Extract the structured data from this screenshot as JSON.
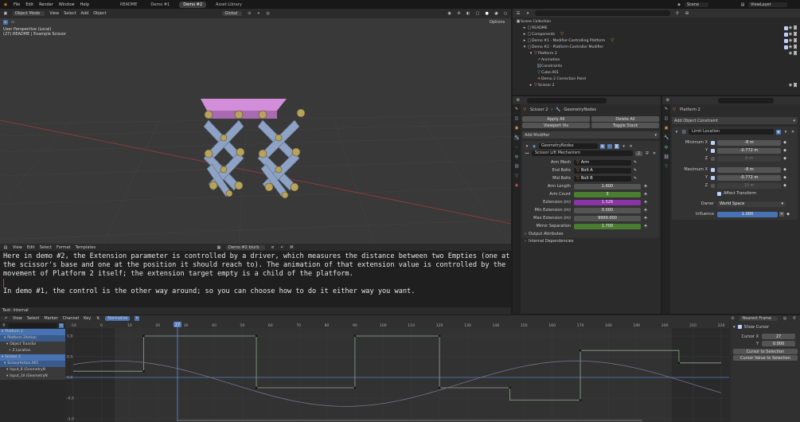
{
  "topbar": {
    "menus": [
      "File",
      "Edit",
      "Render",
      "Window",
      "Help"
    ],
    "tabs": [
      "README",
      "Demo #1",
      "Demo #2",
      "Asset Library"
    ],
    "active_tab": "Demo #2",
    "scene": "Scene",
    "view_layer": "ViewLayer"
  },
  "viewport": {
    "mode": "Object Mode",
    "menus": [
      "View",
      "Select",
      "Add",
      "Object"
    ],
    "transform": "Global",
    "options": "Options",
    "info_line1": "User Perspective (Local)",
    "info_line2": "(27) README | Example Scissor"
  },
  "text_editor": {
    "menus": [
      "View",
      "Edit",
      "Select",
      "Format",
      "Templates"
    ],
    "file_name": "Demo #2 blurb",
    "lines": [
      "Here in demo #2, the Extension parameter is controlled by a driver, which measures the distance between two Empties (one at",
      "the scissor's base and one at the position it should reach to). The animation of that extension value is controlled by the",
      "movement of Platform 2 itself; the extension target empty is a child of the platform.",
      "",
      "In demo #1, the control is the other way around; so you can choose how to do it either way you want."
    ],
    "status": "Text: Internal"
  },
  "outliner": {
    "items": [
      {
        "label": "Scene Collection",
        "depth": 0
      },
      {
        "label": "README",
        "depth": 1
      },
      {
        "label": "Components",
        "depth": 1
      },
      {
        "label": "Demo #1 - Modifier-Controlling Platform",
        "depth": 1
      },
      {
        "label": "Demo #2 - Platform-Controller Modifier",
        "depth": 1
      },
      {
        "label": "Platform 2",
        "depth": 2
      },
      {
        "label": "Animation",
        "depth": 3
      },
      {
        "label": "Constraints",
        "depth": 3
      },
      {
        "label": "Cube.001",
        "depth": 3
      },
      {
        "label": "Demo 2 Correction Point",
        "depth": 3
      },
      {
        "label": "Scissor 2",
        "depth": 2
      }
    ]
  },
  "modifier_panel": {
    "object": "Scissor 2",
    "node_tree": "GeometryNodes",
    "apply_all": "Apply All",
    "delete_all": "Delete All",
    "viewport_vis": "Viewport Vis",
    "toggle_stack": "Toggle Stack",
    "add_modifier": "Add Modifier",
    "modifier_name": "GeometryNodes",
    "node_group": "Scissor Lift Mechanism",
    "node_group_users": "2",
    "object_fields": [
      {
        "label": "Arm Mesh",
        "value": "Arm"
      },
      {
        "label": "End Bolts",
        "value": "Bolt A"
      },
      {
        "label": "Mid Bolts",
        "value": "Bolt B"
      }
    ],
    "number_fields": [
      {
        "label": "Arm Length",
        "value": "1.600",
        "color": "#545454"
      },
      {
        "label": "Arm Count",
        "value": "3",
        "color": "#4a7d32"
      },
      {
        "label": "Extension (m)",
        "value": "1.526",
        "color": "#8a34a8"
      },
      {
        "label": "Min Extension (m)",
        "value": "0.000",
        "color": "#545454"
      },
      {
        "label": "Max Extension (m)",
        "value": "9999.000",
        "color": "#545454"
      },
      {
        "label": "Mirror Separation",
        "value": "1.700",
        "color": "#4a7d32"
      }
    ],
    "output_attributes": "Output Attributes",
    "internal_deps": "Internal Dependencies"
  },
  "constraint_panel": {
    "object": "Platform 2",
    "add_constraint": "Add Object Constraint",
    "constraint_name": "Limit Location",
    "minimum_x": "Minimum X",
    "min_x_val": "-8 m",
    "min_y_val": "-0.772 m",
    "min_z_val": "0 m",
    "maximum_x": "Maximum X",
    "max_x_val": "-8 m",
    "max_y_val": "-0.772 m",
    "max_z_val": "10 m",
    "y": "Y",
    "z": "Z",
    "affect_transform": "Affect Transform",
    "owner_label": "Owner",
    "owner_value": "World Space",
    "influence_label": "Influence",
    "influence_value": "1.000"
  },
  "graph_editor": {
    "menus": [
      "View",
      "Select",
      "Marker",
      "Channel",
      "Key"
    ],
    "normalize": "Normalize",
    "pivot": "Nearest Frame",
    "frame_ticks": [
      "-10",
      "0",
      "10",
      "20",
      "27",
      "30",
      "40",
      "50",
      "60",
      "70",
      "80",
      "90",
      "100",
      "110",
      "120",
      "130",
      "140",
      "150",
      "160",
      "170",
      "180",
      "190",
      "200",
      "210",
      "220"
    ],
    "current_frame": "27",
    "y_ticks": [
      "1.0",
      "0.5",
      "0.0",
      "-0.5",
      "-1.0"
    ],
    "channels": [
      {
        "label": "Platform 2",
        "color": "#4772b3",
        "depth": 0
      },
      {
        "label": "Platform 2Action",
        "color": "#3a5a8a",
        "depth": 1
      },
      {
        "label": "Object Transfor",
        "color": "#3a3a3a",
        "depth": 2
      },
      {
        "label": "Z Location",
        "color": "#3a3a3a",
        "depth": 3
      },
      {
        "label": "Scissor 2",
        "color": "#4772b3",
        "depth": 0
      },
      {
        "label": "ScissorAction.001",
        "color": "#3a5a8a",
        "depth": 1
      },
      {
        "label": "Input_8 (GeometryN",
        "color": "#3a3a3a",
        "depth": 2
      },
      {
        "label": "Input_10 (GeometryN",
        "color": "#3a3a3a",
        "depth": 2
      }
    ],
    "show_cursor": "Show Cursor",
    "cursor_x_label": "Cursor X",
    "cursor_x": "27",
    "cursor_y_label": "Y",
    "cursor_y": "0.000",
    "cursor_to_selection": "Cursor to Selection",
    "cursor_value_to_selection": "Cursor Value to Selection"
  },
  "colors": {
    "accent": "#4772b3",
    "platform": "#d28ed8",
    "scissor": "#8ea2c4",
    "bolt": "#b7a35c",
    "playhead": "#5680c2"
  }
}
